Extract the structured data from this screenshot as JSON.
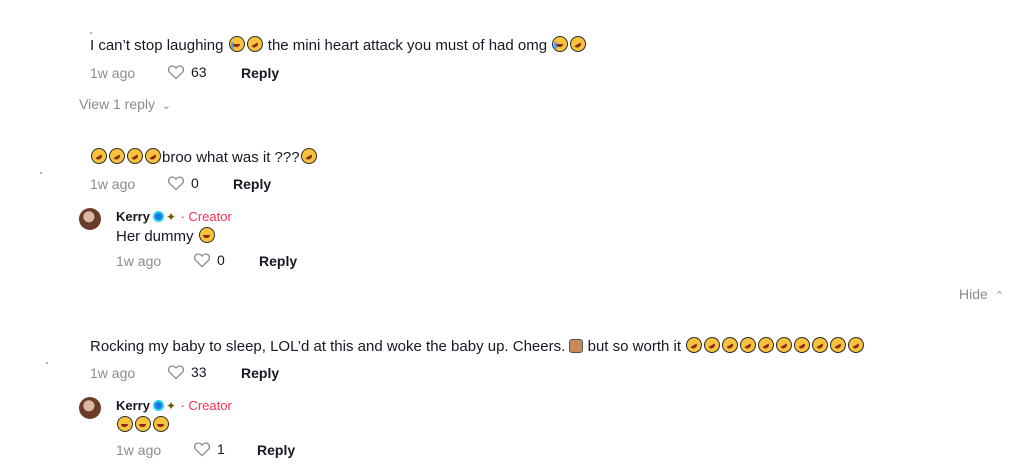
{
  "comments": [
    {
      "text": "I can’t stop laughing",
      "text_mid": "the mini heart attack you must of had omg",
      "time": "1w ago",
      "likes": "63",
      "reply_label": "Reply",
      "view_replies": "View 1 reply"
    },
    {
      "text": "broo what was it ???",
      "time": "1w ago",
      "likes": "0",
      "reply_label": "Reply",
      "reply": {
        "author": "Kerry",
        "creator_label": "· Creator",
        "text": "Her dummy",
        "time": "1w ago",
        "likes": "0",
        "reply_label": "Reply"
      }
    },
    {
      "text": "Rocking my baby to sleep, LOL’d at this and woke the baby up. Cheers.",
      "text_end": "but so worth it",
      "time": "1w ago",
      "likes": "33",
      "reply_label": "Reply",
      "reply": {
        "author": "Kerry",
        "creator_label": "· Creator",
        "time": "1w ago",
        "likes": "1",
        "reply_label": "Reply"
      }
    }
  ],
  "hide_label": "Hide",
  "icons": {
    "like": "heart-outline-icon",
    "emoji_laugh": "rofl-emoji",
    "emoji_sob": "loudly-crying-emoji",
    "emoji_joy": "grinning-emoji",
    "thumbs_up": "thumbs-up-emoji"
  }
}
